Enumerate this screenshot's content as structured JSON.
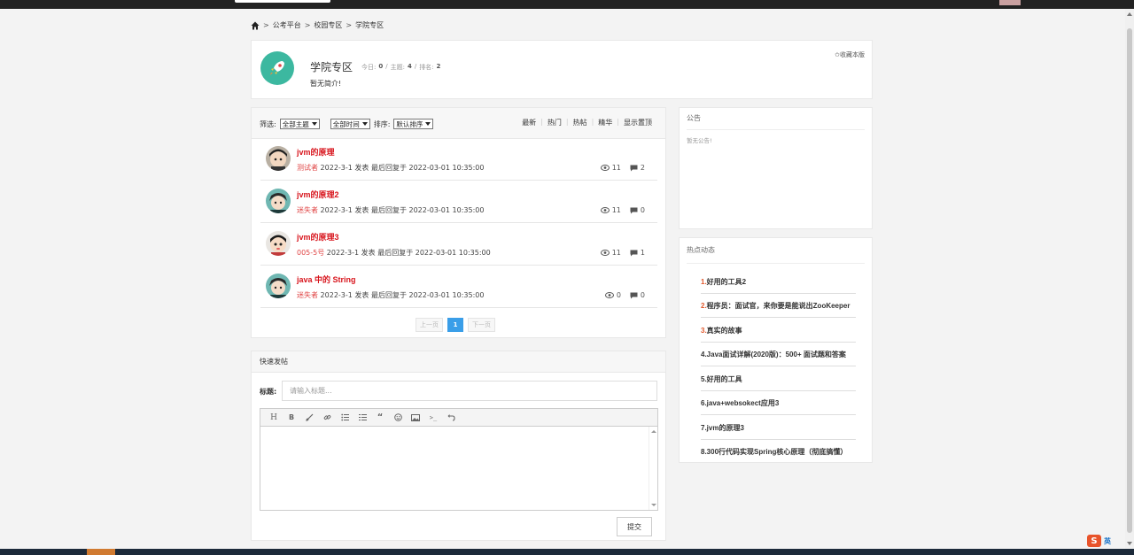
{
  "breadcrumb": {
    "items": [
      "公考平台",
      "校园专区",
      "学院专区"
    ]
  },
  "forum": {
    "name": "学院专区",
    "today_label": "今日:",
    "today_value": "0",
    "topics_label": "主题:",
    "topics_value": "4",
    "rank_label": "排名:",
    "rank_value": "2",
    "description": "暂无简介!",
    "favorite_label": "✩收藏本版"
  },
  "filter": {
    "label": "筛选:",
    "topic_select": "全部主题",
    "time_select": "全部时间",
    "sort_label": "排序:",
    "sort_select": "默认排序",
    "tabs": [
      "最新",
      "热门",
      "热帖",
      "精华",
      "显示置顶"
    ]
  },
  "topics": [
    {
      "title": "jvm的原理",
      "author": "测试者",
      "meta": "2022-3-1 发表 最后回复于 2022-03-01 10:35:00",
      "views": "11",
      "replies": "2"
    },
    {
      "title": "jvm的原理2",
      "author": "迷失者",
      "meta": "2022-3-1 发表 最后回复于 2022-03-01 10:35:00",
      "views": "11",
      "replies": "0"
    },
    {
      "title": "jvm的原理3",
      "author": "005-5号",
      "meta": "2022-3-1 发表 最后回复于 2022-03-01 10:35:00",
      "views": "11",
      "replies": "1"
    },
    {
      "title": "java 中的 String",
      "author": "迷失者",
      "meta": "2022-3-1 发表 最后回复于 2022-03-01 10:35:00",
      "views": "0",
      "replies": "0"
    }
  ],
  "pager": {
    "prev": "上一页",
    "current": "1",
    "next": "下一页"
  },
  "quick_post": {
    "heading": "快速发帖",
    "title_label": "标题:",
    "title_placeholder": "请输入标题...",
    "submit_label": "提交",
    "toolbar_icons": [
      "heading-icon",
      "bold-icon",
      "brush-icon",
      "link-icon",
      "bullet-list-icon",
      "ordered-list-icon",
      "quote-icon",
      "emoji-icon",
      "image-icon",
      "code-icon",
      "undo-icon"
    ]
  },
  "notice": {
    "title": "公告",
    "text": "暂无公告!"
  },
  "hot": {
    "title": "热点动态",
    "items": [
      {
        "rank": "1.",
        "text": "好用的工具2"
      },
      {
        "rank": "2.",
        "text": "程序员：面试官，来你要是能说出ZooKeeper"
      },
      {
        "rank": "3.",
        "text": "真实的故事"
      },
      {
        "rank": "4.",
        "text": "Java面试详解(2020版)：500+ 面试题和答案"
      },
      {
        "rank": "5.",
        "text": "好用的工具"
      },
      {
        "rank": "6.",
        "text": "java+websokect应用3"
      },
      {
        "rank": "7.",
        "text": "jvm的原理3"
      },
      {
        "rank": "8.",
        "text": "300行代码实现Spring核心原理（彻底搞懂）"
      }
    ]
  },
  "ime": {
    "label": "英"
  },
  "colors": {
    "accent": "#d8151d",
    "pager_active": "#3a9ee8",
    "logo_bg": "#3cb8a0",
    "hot_rank": "#e25a2e"
  }
}
